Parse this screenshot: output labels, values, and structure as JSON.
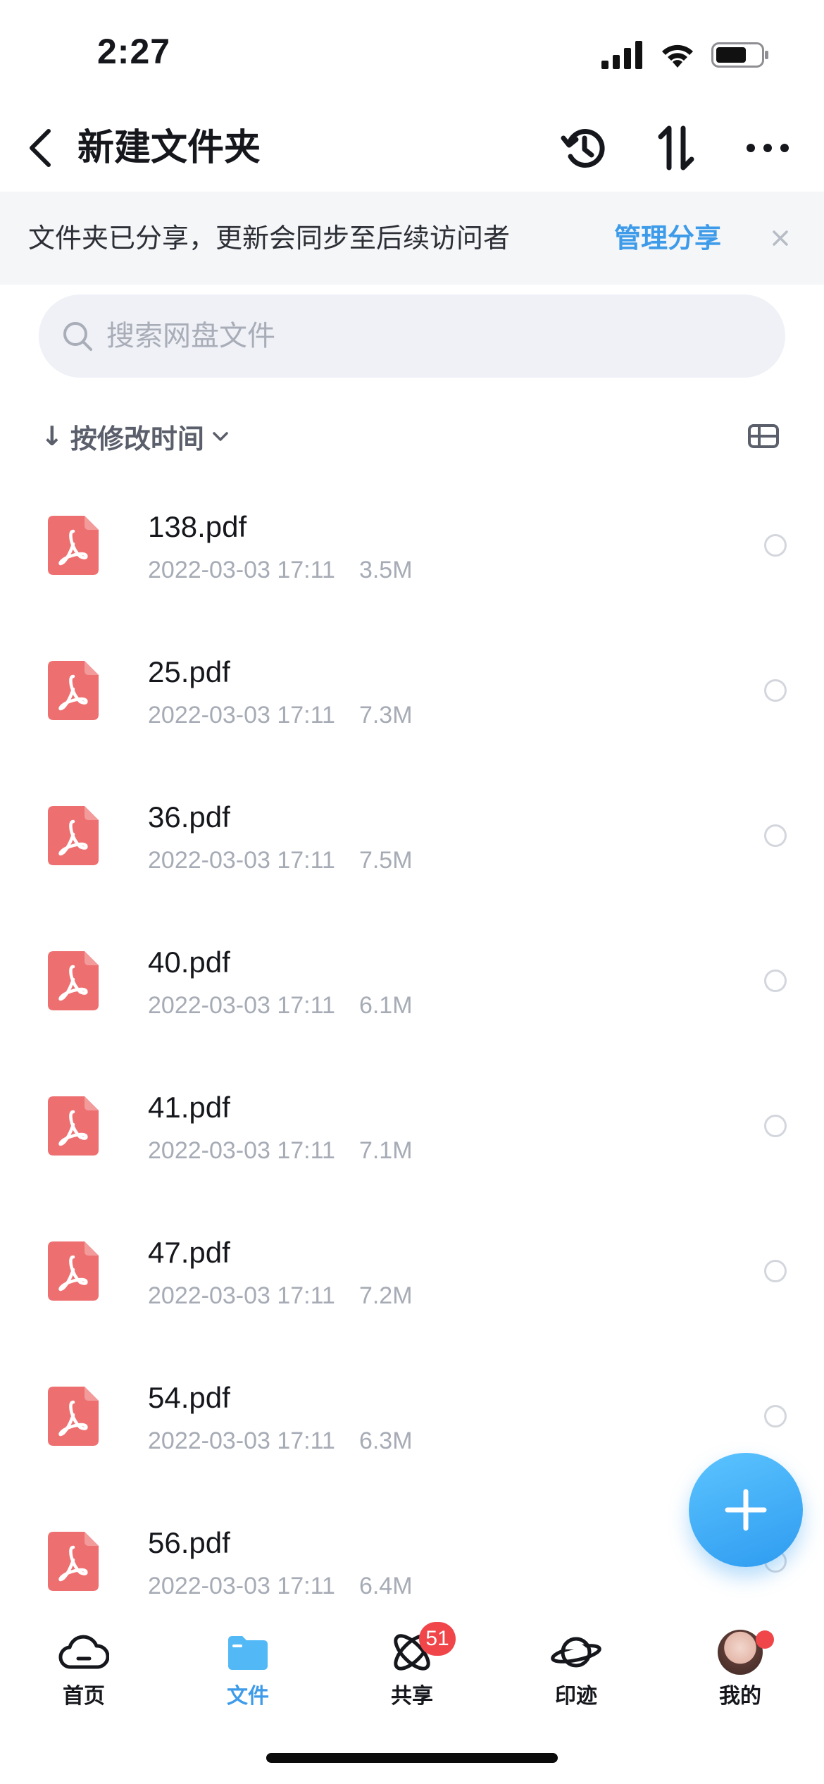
{
  "status_bar": {
    "time": "2:27"
  },
  "nav": {
    "title": "新建文件夹",
    "icons": [
      "back-arrow-icon",
      "history-icon",
      "sort-arrows-icon",
      "more-icon"
    ]
  },
  "share_banner": {
    "text": "文件夹已分享，更新会同步至后续访问者",
    "link": "管理分享"
  },
  "search": {
    "placeholder": "搜索网盘文件"
  },
  "sort": {
    "arrow": "↓",
    "label": "按修改时间"
  },
  "files": [
    {
      "name": "138.pdf",
      "date": "2022-03-03 17:11",
      "size": "3.5M"
    },
    {
      "name": "25.pdf",
      "date": "2022-03-03 17:11",
      "size": "7.3M"
    },
    {
      "name": "36.pdf",
      "date": "2022-03-03 17:11",
      "size": "7.5M"
    },
    {
      "name": "40.pdf",
      "date": "2022-03-03 17:11",
      "size": "6.1M"
    },
    {
      "name": "41.pdf",
      "date": "2022-03-03 17:11",
      "size": "7.1M"
    },
    {
      "name": "47.pdf",
      "date": "2022-03-03 17:11",
      "size": "7.2M"
    },
    {
      "name": "54.pdf",
      "date": "2022-03-03 17:11",
      "size": "6.3M"
    },
    {
      "name": "56.pdf",
      "date": "2022-03-03 17:11",
      "size": "6.4M"
    }
  ],
  "tabs": [
    {
      "label": "首页",
      "icon": "cloud-icon",
      "active": false
    },
    {
      "label": "文件",
      "icon": "folder-icon",
      "active": true
    },
    {
      "label": "共享",
      "icon": "share-orbit-icon",
      "active": false,
      "badge": "51"
    },
    {
      "label": "印迹",
      "icon": "planet-icon",
      "active": false
    },
    {
      "label": "我的",
      "icon": "avatar",
      "active": false
    }
  ],
  "colors": {
    "accent": "#3d9be9",
    "pdf": "#ee6f70",
    "badge": "#f0464a"
  }
}
